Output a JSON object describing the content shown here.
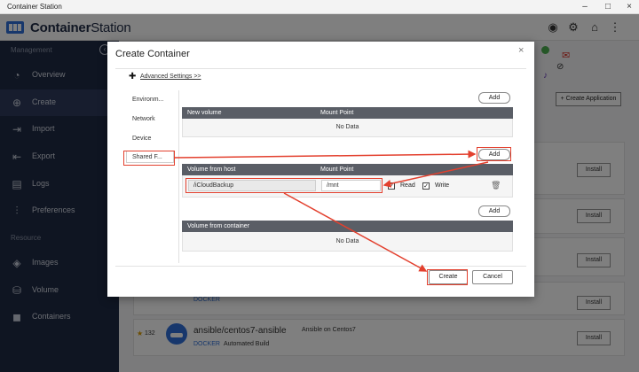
{
  "window": {
    "title": "Container Station"
  },
  "app": {
    "logo_bold": "Container",
    "logo_thin": "Station"
  },
  "sidebar": {
    "management_label": "Management",
    "resource_label": "Resource",
    "items": [
      {
        "label": "Overview",
        "icon": "speedometer-icon"
      },
      {
        "label": "Create",
        "icon": "plus-circle-icon"
      },
      {
        "label": "Import",
        "icon": "import-icon"
      },
      {
        "label": "Export",
        "icon": "export-icon"
      },
      {
        "label": "Logs",
        "icon": "logs-icon"
      },
      {
        "label": "Preferences",
        "icon": "sliders-icon"
      }
    ],
    "resource_items": [
      {
        "label": "Images",
        "icon": "layers-icon"
      },
      {
        "label": "Volume",
        "icon": "database-icon"
      },
      {
        "label": "Containers",
        "icon": "cube-icon"
      }
    ]
  },
  "background": {
    "create_application": "+ Create Application",
    "install": "Install",
    "row1_badge": "DOCKER",
    "row2": {
      "stars": "132",
      "name": "ansible/centos7-ansible",
      "desc": "Ansible on Centos7",
      "badge": "DOCKER",
      "build": "Automated Build"
    }
  },
  "modal": {
    "title": "Create Container",
    "close": "×",
    "advanced_settings": "Advanced Settings >>",
    "tabs": [
      "Environm...",
      "Network",
      "Device",
      "Shared F..."
    ],
    "add_label": "Add",
    "new_volume": {
      "col1": "New volume",
      "col2": "Mount Point",
      "empty": "No Data"
    },
    "host_volume": {
      "col1": "Volume from host",
      "col2": "Mount Point",
      "path": "/iCloudBackup",
      "mount": "/mnt",
      "read": "Read",
      "write": "Write"
    },
    "container_volume": {
      "col1": "Volume from container",
      "empty": "No Data"
    },
    "create": "Create",
    "cancel": "Cancel"
  },
  "colors": {
    "sidebar_bg": "#1f2a44",
    "annotation": "#e3402e",
    "table_header": "#5a5e66"
  }
}
